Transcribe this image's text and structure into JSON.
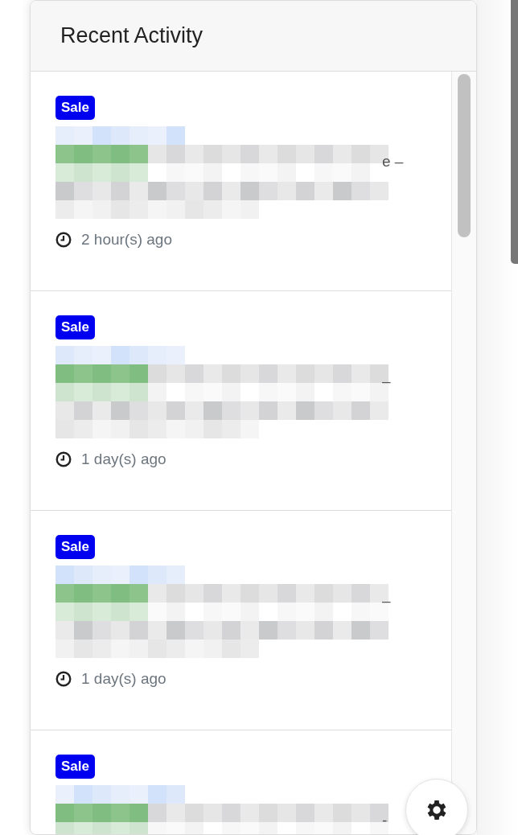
{
  "panel": {
    "title": "Recent Activity"
  },
  "activities": [
    {
      "badge": "Sale",
      "tail": "e –",
      "time": "2 hour(s) ago"
    },
    {
      "badge": "Sale",
      "tail": "–",
      "time": "1 day(s) ago"
    },
    {
      "badge": "Sale",
      "tail": "–",
      "time": "1 day(s) ago"
    },
    {
      "badge": "Sale",
      "tail": "-"
    }
  ]
}
